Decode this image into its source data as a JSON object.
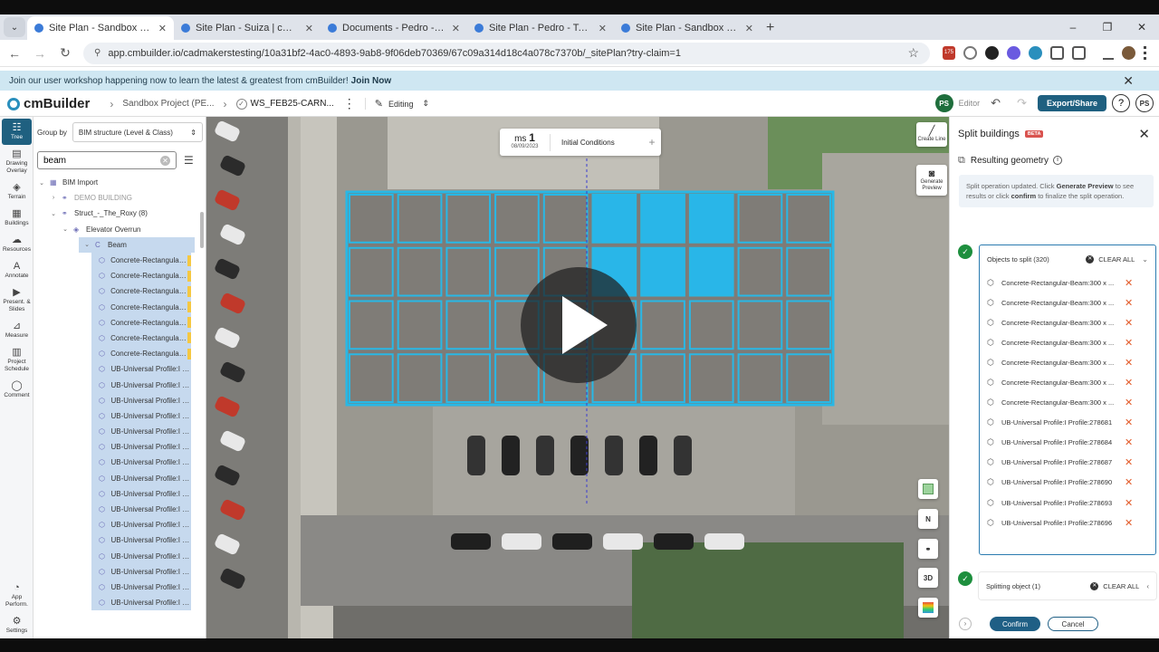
{
  "browser": {
    "tabs": [
      {
        "title": "Site Plan - Sandbox Project (PE",
        "active": true
      },
      {
        "title": "Site Plan - Suiza | cmBuilder",
        "active": false
      },
      {
        "title": "Documents - Pedro - Topo | cm",
        "active": false
      },
      {
        "title": "Site Plan - Pedro - Topo | cmBu",
        "active": false
      },
      {
        "title": "Site Plan - Sandbox Project (PE",
        "active": false
      }
    ],
    "url": "app.cmbuilder.io/cadmakerstesting/10a31bf2-4ac0-4893-9ab8-9f06deb70369/67c09a314d18c4a078c7370b/_sitePlan?try-claim=1",
    "ext_badge": "175"
  },
  "banner": {
    "text": "Join our user workshop happening now to learn the latest & greatest from cmBuilder!",
    "link": "Join Now"
  },
  "header": {
    "logo": "cmBuilder",
    "project": "Sandbox Project (PE...",
    "file": "WS_FEB25-CARN...",
    "mode": "Editing",
    "avatar": "PS",
    "role": "Editor",
    "export": "Export/Share",
    "help": "?",
    "user": "PS"
  },
  "left_toolbar": [
    {
      "label": "Tree",
      "icon": "tree-icon",
      "glyph": "☷",
      "active": true
    },
    {
      "label": "Drawing Overlay",
      "icon": "drawing-overlay-icon",
      "glyph": "▤",
      "active": false
    },
    {
      "label": "Terrain",
      "icon": "terrain-icon",
      "glyph": "◈",
      "active": false
    },
    {
      "label": "Buildings",
      "icon": "buildings-icon",
      "glyph": "▦",
      "active": false
    },
    {
      "label": "Resources",
      "icon": "resources-icon",
      "glyph": "☁",
      "active": false
    },
    {
      "label": "Annotate",
      "icon": "annotate-icon",
      "glyph": "A",
      "active": false
    },
    {
      "label": "Present. & Slides",
      "icon": "slides-icon",
      "glyph": "▶",
      "active": false
    },
    {
      "label": "Measure",
      "icon": "measure-icon",
      "glyph": "⊿",
      "active": false
    },
    {
      "label": "Project Schedule",
      "icon": "schedule-icon",
      "glyph": "▥",
      "active": false
    },
    {
      "label": "Comment",
      "icon": "comment-icon",
      "glyph": "◯",
      "active": false
    }
  ],
  "left_toolbar_bottom": [
    {
      "label": "App Perform.",
      "icon": "performance-icon",
      "glyph": "◔"
    },
    {
      "label": "Settings",
      "icon": "settings-icon",
      "glyph": "⚙"
    }
  ],
  "tree": {
    "group_by_label": "Group by",
    "group_by_value": "BIM structure (Level & Class)",
    "search_value": "beam",
    "nodes": [
      {
        "label": "BIM Import",
        "caret": "⌄",
        "indent": 0,
        "icon": "▦",
        "grey": false,
        "sel": false,
        "tail": false
      },
      {
        "label": "DEMO BUILDING",
        "caret": "›",
        "indent": 1,
        "icon": "⚭",
        "grey": true,
        "sel": false,
        "tail": false
      },
      {
        "label": "Struct_-_The_Roxy (8)",
        "caret": "⌄",
        "indent": 1,
        "icon": "⚭",
        "grey": false,
        "sel": false,
        "tail": false
      },
      {
        "label": "Elevator Overrun",
        "caret": "⌄",
        "indent": 2,
        "icon": "◈",
        "grey": false,
        "sel": false,
        "tail": false
      },
      {
        "label": "Beam",
        "caret": "⌄",
        "indent": 3,
        "icon": "C",
        "grey": false,
        "sel": true,
        "tail": false
      },
      {
        "label": "Concrete-Rectangular-B...",
        "caret": "",
        "indent": 4,
        "icon": "⬡",
        "grey": false,
        "sel": true,
        "tail": true
      },
      {
        "label": "Concrete-Rectangular-B...",
        "caret": "",
        "indent": 4,
        "icon": "⬡",
        "grey": false,
        "sel": true,
        "tail": true
      },
      {
        "label": "Concrete-Rectangular-B...",
        "caret": "",
        "indent": 4,
        "icon": "⬡",
        "grey": false,
        "sel": true,
        "tail": true
      },
      {
        "label": "Concrete-Rectangular-B...",
        "caret": "",
        "indent": 4,
        "icon": "⬡",
        "grey": false,
        "sel": true,
        "tail": true
      },
      {
        "label": "Concrete-Rectangular-B...",
        "caret": "",
        "indent": 4,
        "icon": "⬡",
        "grey": false,
        "sel": true,
        "tail": true
      },
      {
        "label": "Concrete-Rectangular-B...",
        "caret": "",
        "indent": 4,
        "icon": "⬡",
        "grey": false,
        "sel": true,
        "tail": true
      },
      {
        "label": "Concrete-Rectangular-B...",
        "caret": "",
        "indent": 4,
        "icon": "⬡",
        "grey": false,
        "sel": true,
        "tail": true
      },
      {
        "label": "UB-Universal Profile:I Pr...",
        "caret": "",
        "indent": 4,
        "icon": "⬡",
        "grey": false,
        "sel": true,
        "tail": false
      },
      {
        "label": "UB-Universal Profile:I Pr...",
        "caret": "",
        "indent": 4,
        "icon": "⬡",
        "grey": false,
        "sel": true,
        "tail": false
      },
      {
        "label": "UB-Universal Profile:I Pr...",
        "caret": "",
        "indent": 4,
        "icon": "⬡",
        "grey": false,
        "sel": true,
        "tail": false
      },
      {
        "label": "UB-Universal Profile:I Pr...",
        "caret": "",
        "indent": 4,
        "icon": "⬡",
        "grey": false,
        "sel": true,
        "tail": false
      },
      {
        "label": "UB-Universal Profile:I Pr...",
        "caret": "",
        "indent": 4,
        "icon": "⬡",
        "grey": false,
        "sel": true,
        "tail": false
      },
      {
        "label": "UB-Universal Profile:I Pr...",
        "caret": "",
        "indent": 4,
        "icon": "⬡",
        "grey": false,
        "sel": true,
        "tail": false
      },
      {
        "label": "UB-Universal Profile:I Pr...",
        "caret": "",
        "indent": 4,
        "icon": "⬡",
        "grey": false,
        "sel": true,
        "tail": false
      },
      {
        "label": "UB-Universal Profile:I Pr...",
        "caret": "",
        "indent": 4,
        "icon": "⬡",
        "grey": false,
        "sel": true,
        "tail": false
      },
      {
        "label": "UB-Universal Profile:I Pr...",
        "caret": "",
        "indent": 4,
        "icon": "⬡",
        "grey": false,
        "sel": true,
        "tail": false
      },
      {
        "label": "UB-Universal Profile:I Pr...",
        "caret": "",
        "indent": 4,
        "icon": "⬡",
        "grey": false,
        "sel": true,
        "tail": false
      },
      {
        "label": "UB-Universal Profile:I Pr...",
        "caret": "",
        "indent": 4,
        "icon": "⬡",
        "grey": false,
        "sel": true,
        "tail": false
      },
      {
        "label": "UB-Universal Profile:I Pr...",
        "caret": "",
        "indent": 4,
        "icon": "⬡",
        "grey": false,
        "sel": true,
        "tail": false
      },
      {
        "label": "UB-Universal Profile:I Pr...",
        "caret": "",
        "indent": 4,
        "icon": "⬡",
        "grey": false,
        "sel": true,
        "tail": false
      },
      {
        "label": "UB-Universal Profile:I Pr...",
        "caret": "",
        "indent": 4,
        "icon": "⬡",
        "grey": false,
        "sel": true,
        "tail": false
      },
      {
        "label": "UB-Universal Profile:I Pr...",
        "caret": "",
        "indent": 4,
        "icon": "⬡",
        "grey": false,
        "sel": true,
        "tail": false
      },
      {
        "label": "UB-Universal Profile:I Pr...",
        "caret": "",
        "indent": 4,
        "icon": "⬡",
        "grey": false,
        "sel": true,
        "tail": false
      }
    ]
  },
  "map": {
    "phase_prefix": "ms",
    "phase_number": "1",
    "phase_date": "08/09/2023",
    "phase_name": "Initial Conditions",
    "create_line": "Create Line",
    "generate_preview": "Generate Preview",
    "north": "N",
    "view_3d": "3D"
  },
  "split_panel": {
    "title": "Split buildings",
    "badge": "BETA",
    "section": "Resulting geometry",
    "note_1": "Split operation updated. Click",
    "note_bold_1": "Generate Preview",
    "note_2": "to see results or click",
    "note_bold_2": "confirm",
    "note_3": "to finalize the split operation.",
    "objects_label": "Objects to split (320)",
    "clear_all": "CLEAR ALL",
    "objects": [
      "Concrete-Rectangular-Beam:300 x ...",
      "Concrete-Rectangular-Beam:300 x ...",
      "Concrete-Rectangular-Beam:300 x ...",
      "Concrete-Rectangular-Beam:300 x ...",
      "Concrete-Rectangular-Beam:300 x ...",
      "Concrete-Rectangular-Beam:300 x ...",
      "Concrete-Rectangular-Beam:300 x ...",
      "UB-Universal Profile:I Profile:278681",
      "UB-Universal Profile:I Profile:278684",
      "UB-Universal Profile:I Profile:278687",
      "UB-Universal Profile:I Profile:278690",
      "UB-Universal Profile:I Profile:278693",
      "UB-Universal Profile:I Profile:278696"
    ],
    "splitting_label": "Splitting object (1)",
    "confirm": "Confirm",
    "cancel": "Cancel"
  }
}
